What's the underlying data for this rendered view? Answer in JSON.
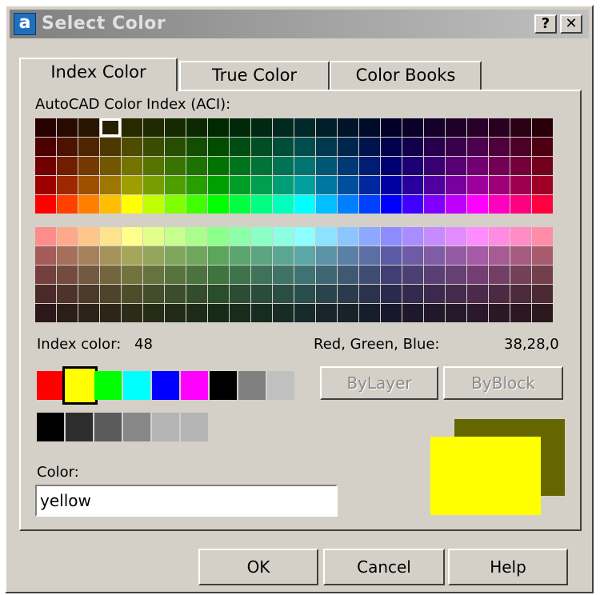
{
  "window": {
    "title": "Select Color",
    "help_button": "?",
    "close_button": "✕"
  },
  "tabs": [
    {
      "label": "Index Color",
      "active": true
    },
    {
      "label": "True Color",
      "active": false
    },
    {
      "label": "Color Books",
      "active": false
    }
  ],
  "aci_label": "AutoCAD Color Index (ACI):",
  "index_color": {
    "label": "Index color:",
    "value": "48"
  },
  "rgb": {
    "label": "Red, Green, Blue:",
    "value": "38,28,0"
  },
  "buttons": {
    "bylayer": "ByLayer",
    "byblock": "ByBlock",
    "ok": "OK",
    "cancel": "Cancel",
    "help": "Help"
  },
  "color_field": {
    "label": "Color:",
    "value": "yellow"
  },
  "standard_colors": [
    "#ff0000",
    "#ffff00",
    "#00ff00",
    "#00ffff",
    "#0000ff",
    "#ff00ff",
    "#000000",
    "#808080",
    "#c0c0c0"
  ],
  "selected_standard_index": 1,
  "gray_colors": [
    "#000000",
    "#2d2d2d",
    "#5b5b5b",
    "#878787",
    "#b4b4b4",
    "#b4b4b4"
  ],
  "preview": {
    "new_color": "#ffff00",
    "old_color": "#666600"
  },
  "palette": {
    "selected_row": 0,
    "selected_col": 3
  }
}
